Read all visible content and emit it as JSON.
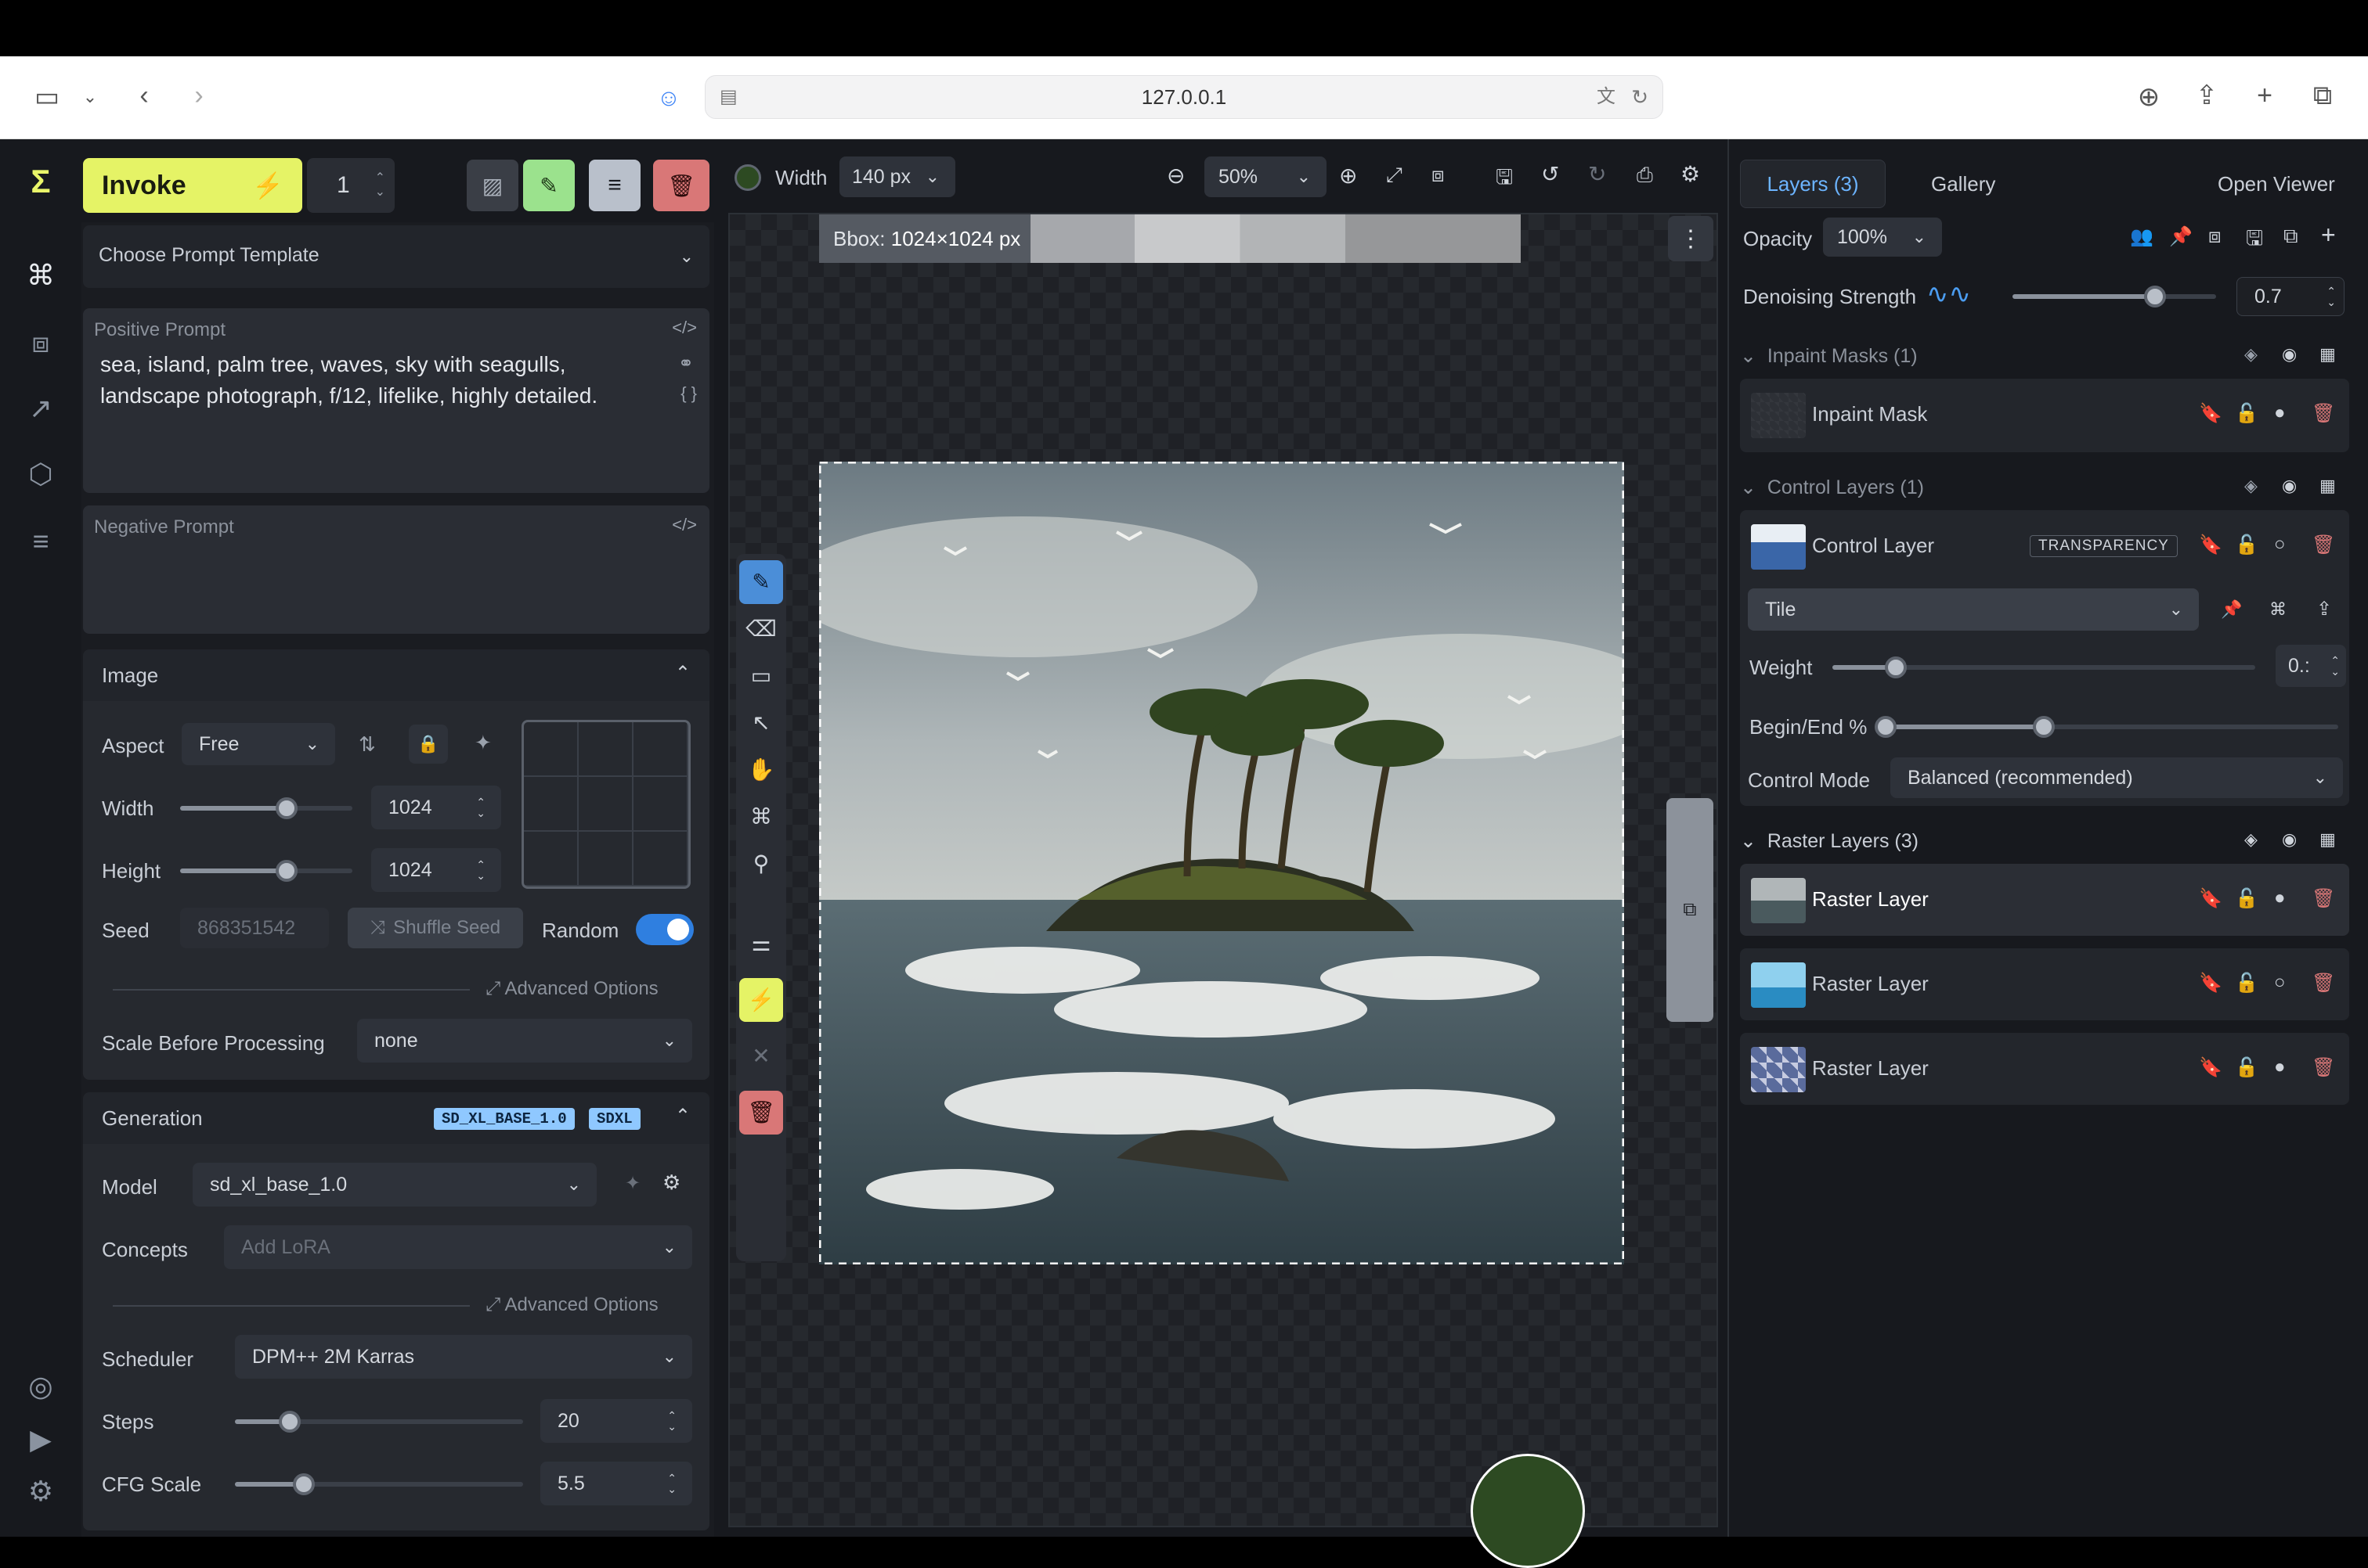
{
  "browser": {
    "url": "127.0.0.1"
  },
  "header": {
    "invoke_label": "Invoke",
    "invoke_count": "1",
    "width_label": "Width",
    "width_value": "140 px",
    "zoom": "50%"
  },
  "left_panel": {
    "prompt_template": "Choose Prompt Template",
    "positive_label": "Positive Prompt",
    "positive_text": "sea, island, palm tree, waves, sky with seagulls, landscape photograph, f/12, lifelike,  highly detailed.",
    "negative_label": "Negative Prompt",
    "image_section": "Image",
    "aspect_label": "Aspect",
    "aspect_value": "Free",
    "width_label": "Width",
    "width_value": "1024",
    "width_fraction": 0.62,
    "height_label": "Height",
    "height_value": "1024",
    "height_fraction": 0.62,
    "seed_label": "Seed",
    "seed_value": "868351542",
    "shuffle_label": "Shuffle Seed",
    "random_label": "Random",
    "advanced_options": "Advanced Options",
    "scale_label": "Scale Before Processing",
    "scale_value": "none",
    "generation_section": "Generation",
    "badge1": "SD_XL_BASE_1.0",
    "badge2": "SDXL",
    "model_label": "Model",
    "model_value": "sd_xl_base_1.0",
    "concepts_label": "Concepts",
    "concepts_placeholder": "Add LoRA",
    "advanced_options2": "Advanced Options",
    "scheduler_label": "Scheduler",
    "scheduler_value": "DPM++ 2M Karras",
    "steps_label": "Steps",
    "steps_value": "20",
    "steps_fraction": 0.19,
    "cfg_label": "CFG Scale",
    "cfg_value": "5.5",
    "cfg_fraction": 0.24
  },
  "canvas": {
    "bbox_label": "Bbox:",
    "bbox_value": "1024×1024 px",
    "brush_color": "#2d4a22"
  },
  "right_panel": {
    "tabs": [
      "Layers (3)",
      "Gallery"
    ],
    "open_viewer": "Open Viewer",
    "opacity_label": "Opacity",
    "opacity_value": "100%",
    "denoise_label": "Denoising Strength",
    "denoise_value": "0.7",
    "denoise_fraction": 0.7,
    "inpaint_group": "Inpaint Masks (1)",
    "inpaint_layer": "Inpaint Mask",
    "control_group": "Control Layers (1)",
    "control_layer": "Control Layer",
    "transparency_badge": "TRANSPARENCY",
    "control_model": "Tile",
    "weight_label": "Weight",
    "weight_value": "0.:",
    "weight_fraction": 0.15,
    "begin_end_label": "Begin/End %",
    "begin_fraction": 0.0,
    "end_fraction": 0.35,
    "control_mode_label": "Control Mode",
    "control_mode_value": "Balanced (recommended)",
    "raster_group": "Raster Layers (3)",
    "raster_layers": [
      "Raster Layer",
      "Raster Layer",
      "Raster Layer"
    ]
  }
}
